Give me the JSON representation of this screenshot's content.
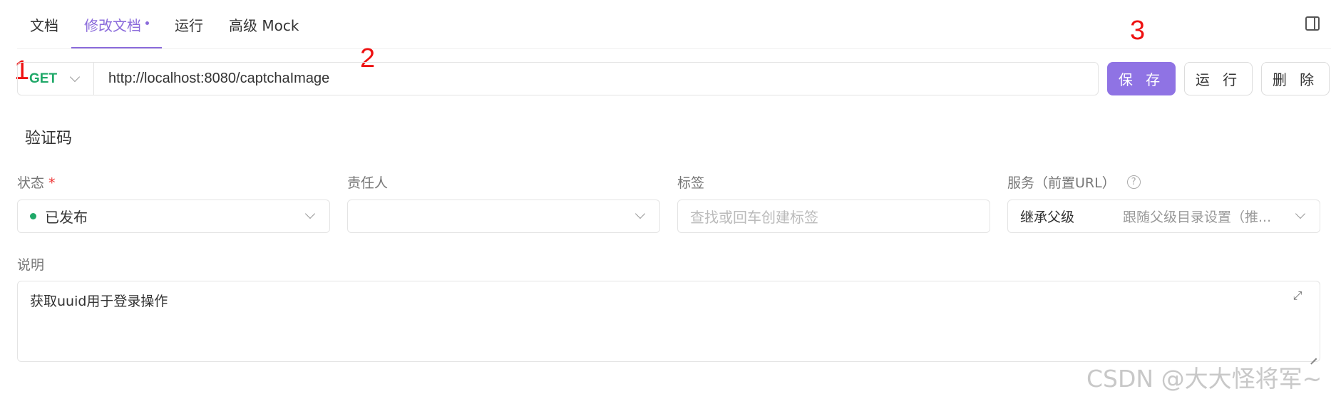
{
  "tabs": [
    {
      "label": "文档",
      "active": false
    },
    {
      "label": "修改文档",
      "active": true,
      "modified": true
    },
    {
      "label": "运行",
      "active": false
    },
    {
      "label": "高级 Mock",
      "active": false
    }
  ],
  "toolbar": {
    "panel_icon": "panel-toggle-icon"
  },
  "annotations": [
    "1",
    "2",
    "3"
  ],
  "request": {
    "method": "GET",
    "method_color": "#1fa868",
    "url": "http://localhost:8080/captchaImage"
  },
  "actions": {
    "save_label": "保 存",
    "run_label": "运 行",
    "delete_label": "删 除"
  },
  "doc": {
    "title": "验证码"
  },
  "fields": {
    "status": {
      "label": "状态",
      "required_mark": "*",
      "value": "已发布",
      "dot_color": "#1fa868"
    },
    "owner": {
      "label": "责任人",
      "value": ""
    },
    "tags": {
      "label": "标签",
      "placeholder": "查找或回车创建标签"
    },
    "service": {
      "label": "服务（前置URL）",
      "mode": "继承父级",
      "value": "跟随父级目录设置（推..."
    }
  },
  "description": {
    "label": "说明",
    "value": "获取uuid用于登录操作"
  },
  "watermark": "CSDN @大大怪将军~",
  "colors": {
    "accent": "#8b6bdb",
    "save_button": "#8f73e4",
    "annotation": "#e11"
  }
}
